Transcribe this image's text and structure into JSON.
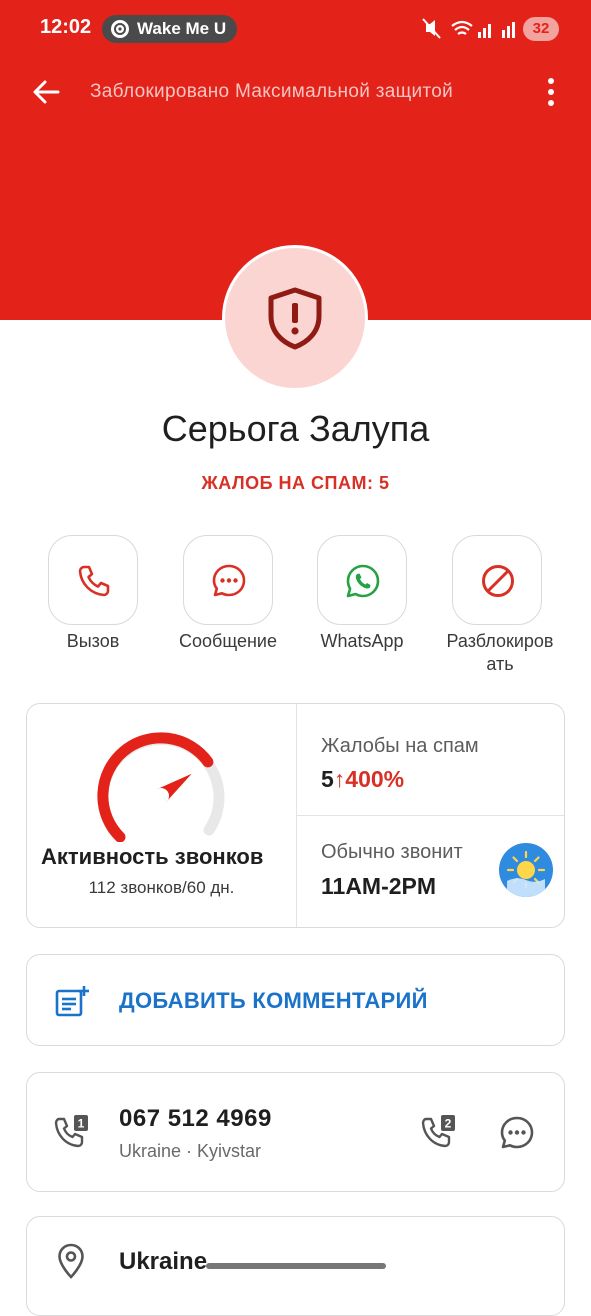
{
  "status_bar": {
    "time": "12:02",
    "notification": "Wake Me U",
    "battery": "32"
  },
  "app_bar": {
    "title": "Заблокировано Максимальной защитой"
  },
  "contact": {
    "name": "Серьога Залупа",
    "spam_reports": "ЖАЛОБ НА СПАМ: 5"
  },
  "actions": [
    {
      "label": "Вызов",
      "icon": "phone-icon"
    },
    {
      "label": "Сообщение",
      "icon": "message-icon"
    },
    {
      "label": "WhatsApp",
      "icon": "whatsapp-icon"
    },
    {
      "label": "Разблокировать",
      "label_line1": "Разблокиров",
      "label_line2": "ать",
      "icon": "block-icon"
    }
  ],
  "stats": {
    "activity_title": "Активность звонков",
    "activity_sub": "112 звонков/60 дн.",
    "gauge_level": 0.7,
    "spam_title": "Жалобы на спам",
    "spam_value": "5",
    "spam_arrow": "↑",
    "spam_change": "400%",
    "usual_title": "Обычно звонит",
    "usual_value": "11AM-2PM"
  },
  "comment": {
    "label": "ДОБАВИТЬ КОММЕНТАРИЙ"
  },
  "phone": {
    "number": "067 512 4969",
    "operator": "Ukraine · Kyivstar"
  },
  "location": {
    "label": "Ukraine"
  },
  "colors": {
    "header_red": "#e32219",
    "spam_red": "#d93025",
    "link_blue": "#1a73c9",
    "whatsapp_green": "#25a244"
  }
}
